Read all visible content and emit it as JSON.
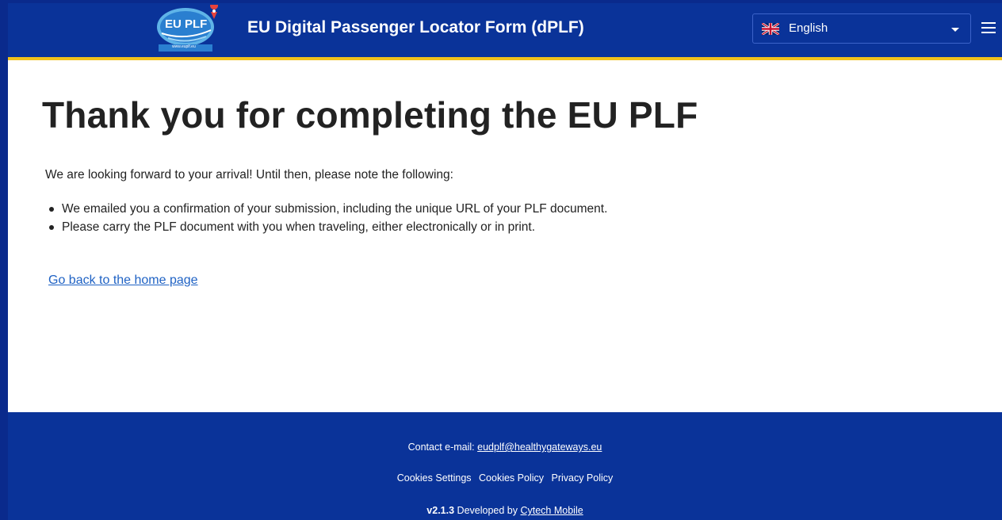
{
  "header": {
    "logo_text": "EU PLF",
    "logo_subtext": "www.euplf.eu",
    "title": "EU Digital Passenger Locator Form (dPLF)",
    "language": "English"
  },
  "main": {
    "title": "Thank you for completing the EU PLF",
    "intro": "We are looking forward to your arrival! Until then, please note the following:",
    "bullets": [
      "We emailed you a confirmation of your submission, including the unique URL of your PLF document.",
      "Please carry the PLF document with you when traveling, either electronically or in print."
    ],
    "home_link": "Go back to the home page"
  },
  "footer": {
    "contact_label": "Contact e-mail:",
    "contact_email": "eudplf@healthygateways.eu",
    "links": [
      "Cookies Settings",
      "Cookies Policy",
      "Privacy Policy"
    ],
    "version": "v2.1.3",
    "developed_by_label": "Developed by",
    "developer": "Cytech Mobile"
  },
  "colors": {
    "brand_blue": "#0a3399",
    "accent_yellow": "#f2c21b",
    "link_blue": "#1f62c4"
  }
}
